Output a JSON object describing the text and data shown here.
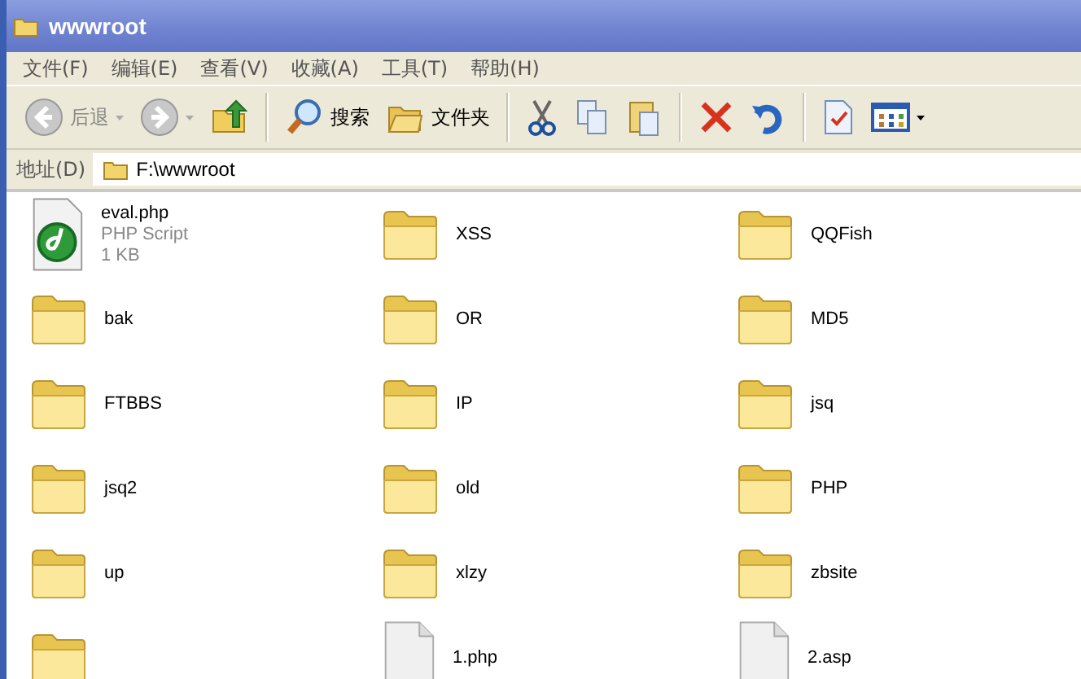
{
  "window": {
    "title": "wwwroot"
  },
  "menu": [
    "文件(F)",
    "编辑(E)",
    "查看(V)",
    "收藏(A)",
    "工具(T)",
    "帮助(H)"
  ],
  "toolbar": [
    {
      "kind": "back",
      "label": "后退",
      "disabled": true
    },
    {
      "kind": "forward",
      "disabled": true
    },
    {
      "kind": "up"
    },
    {
      "kind": "sep"
    },
    {
      "kind": "search",
      "label": "搜索"
    },
    {
      "kind": "folders",
      "label": "文件夹"
    },
    {
      "kind": "sep"
    },
    {
      "kind": "cut"
    },
    {
      "kind": "copy"
    },
    {
      "kind": "paste"
    },
    {
      "kind": "sep"
    },
    {
      "kind": "delete"
    },
    {
      "kind": "undo"
    },
    {
      "kind": "sep"
    },
    {
      "kind": "properties"
    },
    {
      "kind": "views"
    }
  ],
  "address": {
    "label": "地址(D)",
    "value": "F:\\wwwroot"
  },
  "items": [
    {
      "kind": "script",
      "name": "eval.php",
      "type": "PHP Script",
      "size": "1 KB"
    },
    {
      "kind": "folder",
      "name": "XSS"
    },
    {
      "kind": "folder",
      "name": "QQFish"
    },
    {
      "kind": "folder",
      "name": "bak"
    },
    {
      "kind": "folder",
      "name": "OR"
    },
    {
      "kind": "folder",
      "name": "MD5"
    },
    {
      "kind": "folder",
      "name": "FTBBS"
    },
    {
      "kind": "folder",
      "name": "IP"
    },
    {
      "kind": "folder",
      "name": "jsq"
    },
    {
      "kind": "folder",
      "name": "jsq2"
    },
    {
      "kind": "folder",
      "name": "old"
    },
    {
      "kind": "folder",
      "name": "PHP"
    },
    {
      "kind": "folder",
      "name": "up"
    },
    {
      "kind": "folder",
      "name": "xlzy"
    },
    {
      "kind": "folder",
      "name": "zbsite"
    },
    {
      "kind": "folder"
    },
    {
      "kind": "document",
      "name": "1.php"
    },
    {
      "kind": "document",
      "name": "2.asp"
    }
  ]
}
